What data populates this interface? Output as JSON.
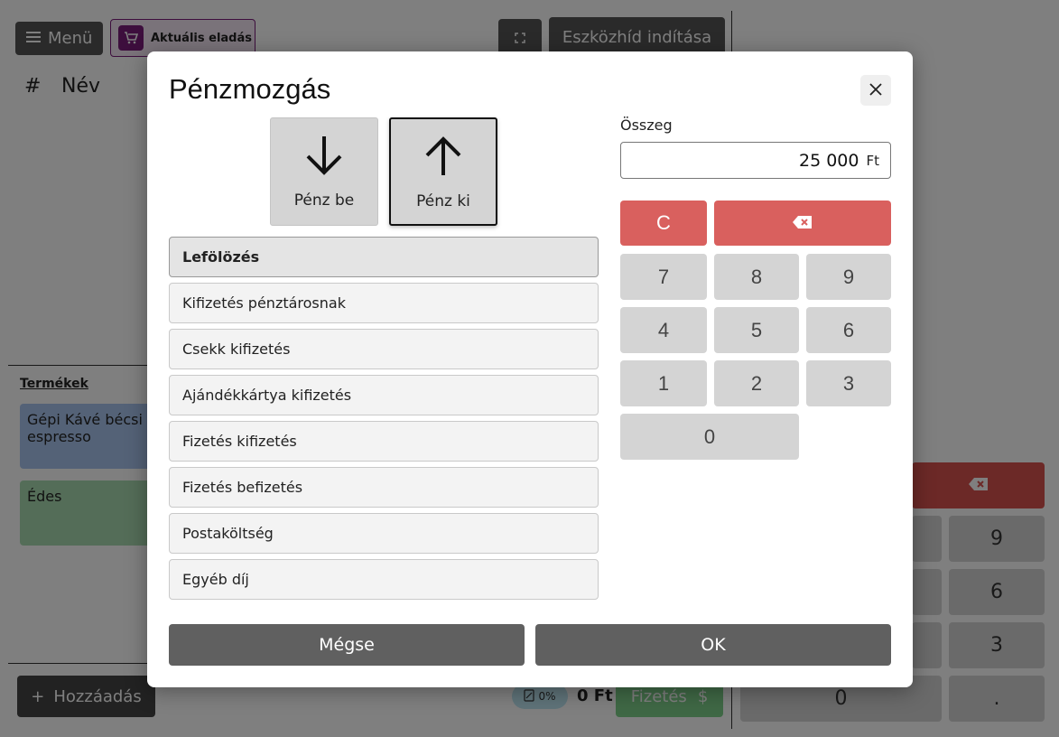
{
  "background": {
    "menu_label": "Menü",
    "current_sale_label": "Aktuális eladás",
    "device_bridge_label": "Eszközhíd indítása",
    "table_header_hash": "#",
    "table_header_name": "Név",
    "products_label": "Termékek",
    "products": [
      "Gépi Kávé bécsi espresso",
      "Édes"
    ],
    "add_label": "Hozzáadás",
    "discount": "0%",
    "total": "0 Ft",
    "pay_label": "Fizetés",
    "pay_symbol": "$",
    "numpad_visible": [
      "9",
      "6",
      "3",
      "0",
      "."
    ]
  },
  "modal": {
    "title": "Pénzmozgás",
    "direction_in_label": "Pénz be",
    "direction_out_label": "Pénz ki",
    "selected_direction": "Pénz ki",
    "categories": [
      "Lefölözés",
      "Kifizetés pénztárosnak",
      "Csekk kifizetés",
      "Ajándékkártya kifizetés",
      "Fizetés kifizetés",
      "Fizetés befizetés",
      "Postaköltség",
      "Egyéb díj"
    ],
    "selected_category": "Lefölözés",
    "amount_label": "Összeg",
    "amount_value": "25 000",
    "currency": "Ft",
    "keypad": {
      "clear": "C",
      "k7": "7",
      "k8": "8",
      "k9": "9",
      "k4": "4",
      "k5": "5",
      "k6": "6",
      "k1": "1",
      "k2": "2",
      "k3": "3",
      "k0": "0"
    },
    "cancel_label": "Mégse",
    "ok_label": "OK"
  },
  "colors": {
    "accent_red": "#d9605e",
    "button_dark": "#606060",
    "cart_accent": "#7a1d7a",
    "pay_green": "#7fd08a"
  }
}
